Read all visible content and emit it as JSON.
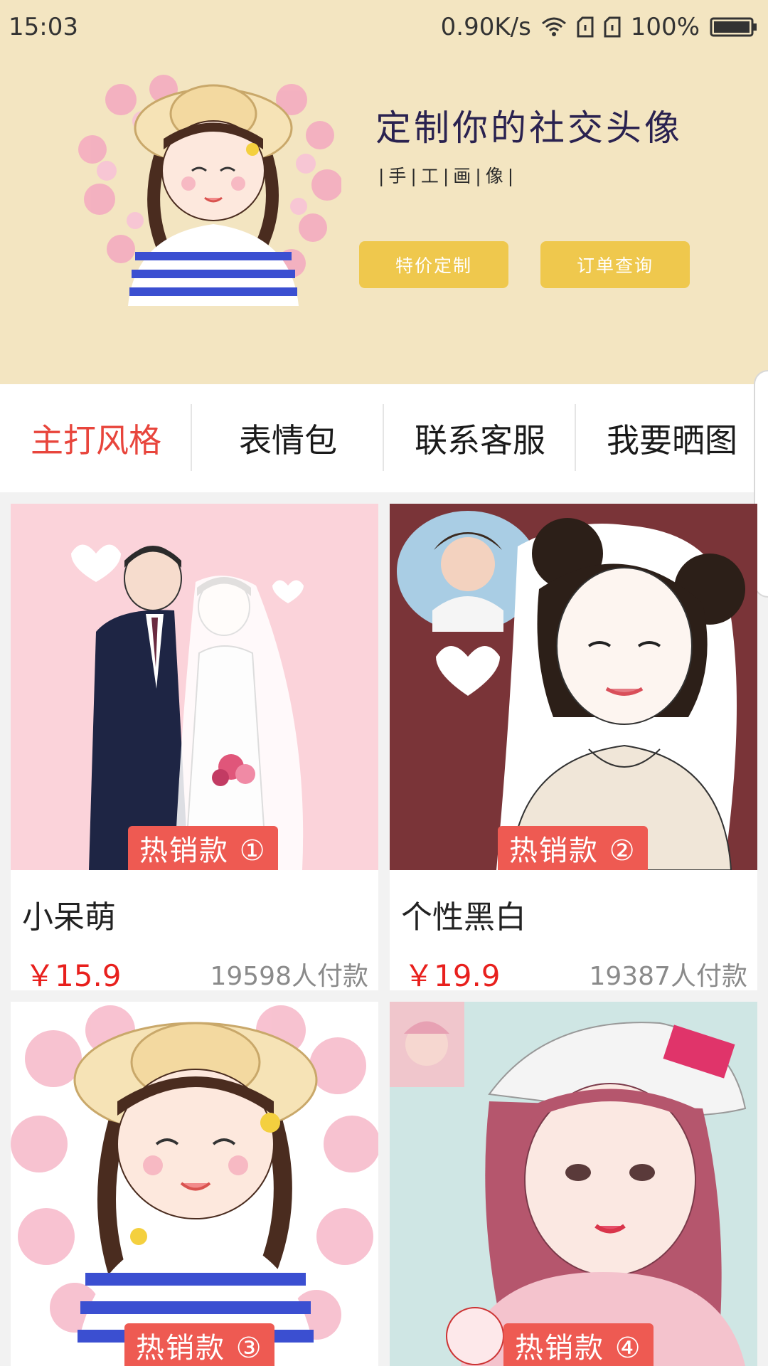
{
  "status_bar": {
    "time": "15:03",
    "speed": "0.90K/s",
    "battery": "100%"
  },
  "hero": {
    "title": "定制你的社交头像",
    "subtitle": "|手|工|画|像|",
    "button_special": "特价定制",
    "button_orders": "订单查询"
  },
  "tabs": [
    {
      "label": "主打风格"
    },
    {
      "label": "表情包"
    },
    {
      "label": "联系客服"
    },
    {
      "label": "我要晒图"
    }
  ],
  "products": [
    {
      "badge": "热销款 ①",
      "name": "小呆萌",
      "price": "￥15.9",
      "sales": "19598人付款"
    },
    {
      "badge": "热销款 ②",
      "name": "个性黑白",
      "price": "￥19.9",
      "sales": "19387人付款"
    },
    {
      "badge": "热销款 ③"
    },
    {
      "badge": "热销款 ④"
    }
  ],
  "colors": {
    "hero_bg": "#f3e5c1",
    "accent_button": "#efc84d",
    "active_tab": "#e8453c",
    "price": "#e8201d",
    "badge": "#ee5a52"
  }
}
